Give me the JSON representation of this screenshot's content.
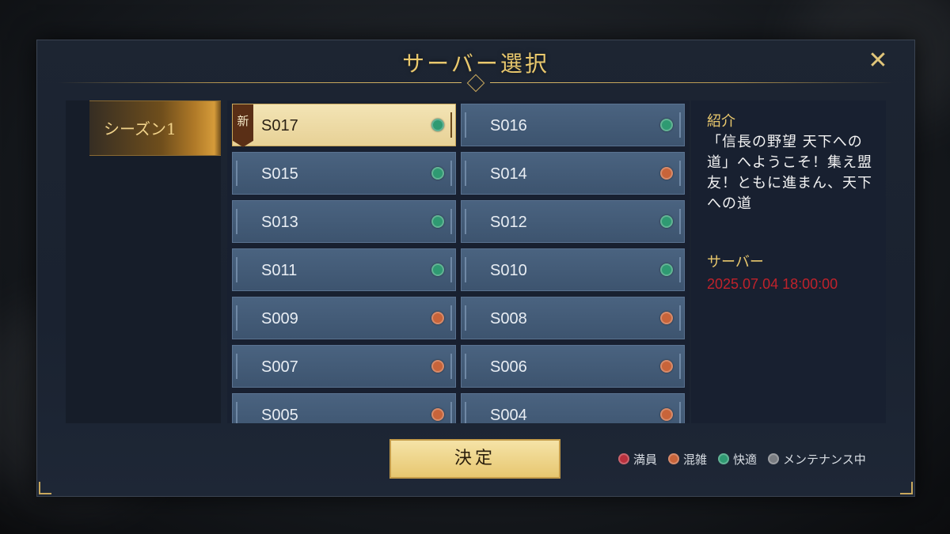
{
  "dialog": {
    "title": "サーバー選択",
    "close_icon": "close-x-icon"
  },
  "seasons": [
    {
      "label": "シーズン1",
      "selected": true
    }
  ],
  "servers": [
    {
      "name": "S017",
      "status": "快適",
      "selected": true,
      "new": true,
      "new_label": "新"
    },
    {
      "name": "S016",
      "status": "快適"
    },
    {
      "name": "S015",
      "status": "快適"
    },
    {
      "name": "S014",
      "status": "混雑"
    },
    {
      "name": "S013",
      "status": "快適"
    },
    {
      "name": "S012",
      "status": "快適"
    },
    {
      "name": "S011",
      "status": "快適"
    },
    {
      "name": "S010",
      "status": "快適"
    },
    {
      "name": "S009",
      "status": "混雑"
    },
    {
      "name": "S008",
      "status": "混雑"
    },
    {
      "name": "S007",
      "status": "混雑"
    },
    {
      "name": "S006",
      "status": "混雑"
    },
    {
      "name": "S005",
      "status": "混雑"
    },
    {
      "name": "S004",
      "status": "混雑"
    }
  ],
  "info": {
    "intro_heading": "紹介",
    "intro_text": "「信長の野望 天下への道」へようこそ！集え盟友！ともに進まん、天下への道",
    "server_heading": "サーバー",
    "server_date": "2025.07.04 18:00:00"
  },
  "confirm_label": "決定",
  "legend": [
    {
      "label": "満員",
      "color": "#b8303d"
    },
    {
      "label": "混雑",
      "color": "#c8643a"
    },
    {
      "label": "快適",
      "color": "#2f9a72"
    },
    {
      "label": "メンテナンス中",
      "color": "#7a7d82"
    }
  ],
  "status_colors": {
    "満員": "#b8303d",
    "混雑": "#c8643a",
    "快適": "#2f9a72",
    "メンテナンス中": "#7a7d82"
  }
}
